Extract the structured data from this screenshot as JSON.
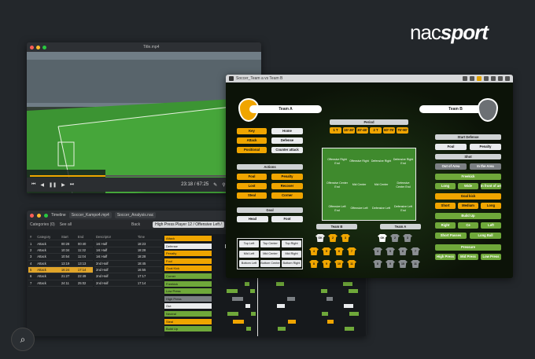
{
  "brand": {
    "logo_a": "nac",
    "logo_b": "sport"
  },
  "video": {
    "title": "Title.mp4",
    "time": "23:18 / 67:25",
    "progress": 0.33
  },
  "timeline": {
    "title": "Timeline",
    "file1": "Soccer_Kampo4.mp4",
    "file2": "Soccer_Analysis.nac",
    "categories_label": "Categories (0)",
    "see_all": "See all",
    "search_label": "Back",
    "header_bar": "High Press Player 12 / Offensive Left /",
    "columns": [
      "#",
      "Category",
      "Start",
      "End"
    ],
    "rows": [
      [
        "1",
        "Attack",
        "00:28",
        "00:40"
      ],
      [
        "2",
        "Attack",
        "10:34",
        "11:32"
      ],
      [
        "3",
        "Attack",
        "10:54",
        "11:04"
      ],
      [
        "4",
        "Attack",
        "13:19",
        "13:13"
      ],
      [
        "5",
        "Attack",
        "16:24",
        "17:14"
      ],
      [
        "6",
        "Attack",
        "21:27",
        "22:49"
      ],
      [
        "7",
        "Attack",
        "24:11",
        "25:02"
      ]
    ],
    "desc_header": "Descriptor",
    "time_header": "Time",
    "descs": [
      [
        "1st Half",
        "18:23"
      ],
      [
        "1st Half",
        "18:28"
      ],
      [
        "1st Half",
        "18:28"
      ],
      [
        "2nd Half",
        "18:45"
      ],
      [
        "2nd Half",
        "16:55"
      ],
      [
        "2nd Half",
        "17:17"
      ],
      [
        "2nd Half",
        "17:14"
      ]
    ],
    "track_labels": [
      "Attack",
      "Defense",
      "Penalty",
      "Foul",
      "Goal Kick",
      "Corner",
      "Freekick",
      "Low Press",
      "High Press",
      "Out",
      "Neutral",
      "Steal",
      "Build Up"
    ]
  },
  "app": {
    "title": "Soccer_Team a vs Team B",
    "team_a": "Team A",
    "team_b": "Team B",
    "period_label": "Period",
    "periods": [
      "1 T",
      "15'-30'",
      "30'-45'",
      "2 T",
      "60'-75'",
      "75'-90'"
    ],
    "left_buttons": [
      [
        "Key",
        "Home"
      ],
      [
        "Attack",
        "Defense"
      ],
      [
        "Positional",
        "Counter attack"
      ]
    ],
    "actions_label": "Actions",
    "actions": [
      [
        "Foul",
        "Penalty"
      ],
      [
        "Lost",
        "Recover"
      ],
      [
        "Steal",
        "Corner"
      ]
    ],
    "goal_label": "Goal",
    "goal_buttons": [
      "Head",
      "Foot"
    ],
    "goal_zones": [
      "Top Left",
      "Top Center",
      "Top Right",
      "Mid Left",
      "Mid Center",
      "Mid Right",
      "Bottom Left",
      "Bottom Center",
      "Bottom Right"
    ],
    "pitch_zones": [
      "Offensive Right End",
      "Offensive Right",
      "Defensive Right",
      "Defensive Right End",
      "Offensive Center End",
      "Mid Center",
      "Mid Center",
      "Defensive Center End",
      "Offensive Left End",
      "Offensive Left",
      "Defensive Left",
      "Defensive Left End"
    ],
    "team_b_label": "Team B",
    "team_a_label": "Team A",
    "right_header": "Start Defense",
    "foul": "Foul",
    "penalty": "Penalty",
    "shot": "Shot",
    "out_of_area": "Out of Area",
    "in_the_area": "In the Area",
    "freekick": "Freekick",
    "fk_options": [
      "Long",
      "Wide",
      "In front of area"
    ],
    "goal_kick": "Goal kick",
    "gk_options": [
      "Short",
      "Medium",
      "Long"
    ],
    "build_up": "Build Up",
    "bu_options": [
      "Right",
      "Ce",
      "Left"
    ],
    "passes": [
      "Short Passes",
      "Long Ball"
    ],
    "pressure": "Pressure",
    "pressure_options": [
      "High Press",
      "Mid Press",
      "Low Press"
    ],
    "player_numbers": [
      "GK",
      "2",
      "3",
      "4",
      "5",
      "6",
      "7",
      "8",
      "9",
      "10",
      "11"
    ]
  }
}
